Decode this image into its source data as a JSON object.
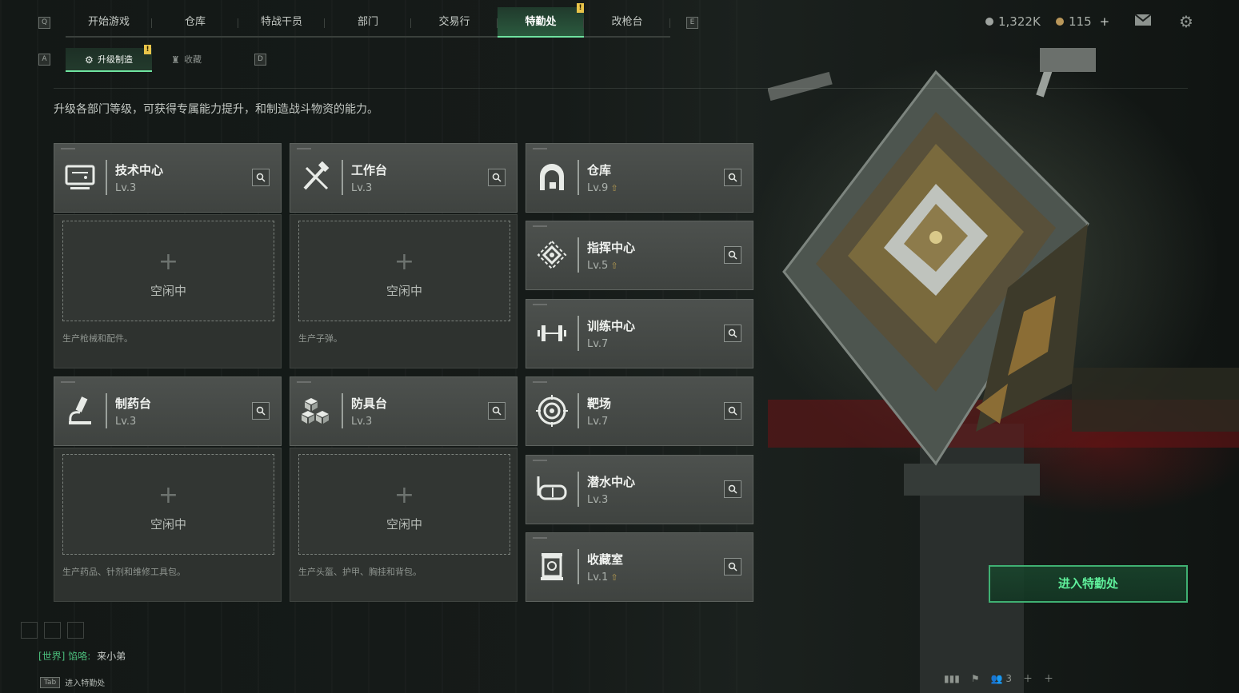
{
  "nav": {
    "left_key": "Q",
    "right_key": "E",
    "tabs": [
      {
        "label": "开始游戏"
      },
      {
        "label": "仓库"
      },
      {
        "label": "特战干员"
      },
      {
        "label": "部门"
      },
      {
        "label": "交易行"
      },
      {
        "label": "特勤处",
        "active": true,
        "badge": "!"
      },
      {
        "label": "改枪台"
      }
    ]
  },
  "currency": {
    "silver": "1,322K",
    "gold": "115",
    "gold_add": "+"
  },
  "subnav": {
    "left_key": "A",
    "right_key": "D",
    "tabs": [
      {
        "label": "升级制造",
        "active": true,
        "badge": "!"
      },
      {
        "label": "收藏"
      }
    ]
  },
  "description": "升级各部门等级，可获得专属能力提升，和制造战斗物资的能力。",
  "stations": [
    {
      "name": "技术中心",
      "level": "Lv.3",
      "icon": "computer-icon",
      "slot": {
        "plus": "+",
        "status": "空闲中",
        "desc": "生产枪械和配件。"
      }
    },
    {
      "name": "工作台",
      "level": "Lv.3",
      "icon": "tools-icon",
      "slot": {
        "plus": "+",
        "status": "空闲中",
        "desc": "生产子弹。"
      }
    },
    {
      "name": "制药台",
      "level": "Lv.3",
      "icon": "microscope-icon",
      "slot": {
        "plus": "+",
        "status": "空闲中",
        "desc": "生产药品、针剂和维修工具包。"
      }
    },
    {
      "name": "防具台",
      "level": "Lv.3",
      "icon": "boxes-icon",
      "slot": {
        "plus": "+",
        "status": "空闲中",
        "desc": "生产头盔、护甲、胸挂和背包。"
      }
    }
  ],
  "departments": [
    {
      "name": "仓库",
      "level": "Lv.9",
      "upgradable": true,
      "icon": "vault-icon"
    },
    {
      "name": "指挥中心",
      "level": "Lv.5",
      "upgradable": true,
      "icon": "command-icon"
    },
    {
      "name": "训练中心",
      "level": "Lv.7",
      "upgradable": false,
      "icon": "dumbbell-icon"
    },
    {
      "name": "靶场",
      "level": "Lv.7",
      "upgradable": false,
      "icon": "target-icon"
    },
    {
      "name": "潜水中心",
      "level": "Lv.3",
      "upgradable": false,
      "icon": "diving-mask-icon"
    },
    {
      "name": "收藏室",
      "level": "Lv.1",
      "upgradable": true,
      "icon": "display-case-icon"
    }
  ],
  "enter_button": "进入特勤处",
  "chat": {
    "channel": "[世界]",
    "sender": "馅咯:",
    "message": "来小弟"
  },
  "tab_hint": {
    "key": "Tab",
    "label": "进入特勤处"
  },
  "bottom_tray": {
    "friends_count": "3"
  },
  "colors": {
    "accent": "#6fe3a0",
    "button_text": "#5ff09b",
    "badge": "#e9c44a",
    "upgrade_arrow": "#b59a50"
  }
}
